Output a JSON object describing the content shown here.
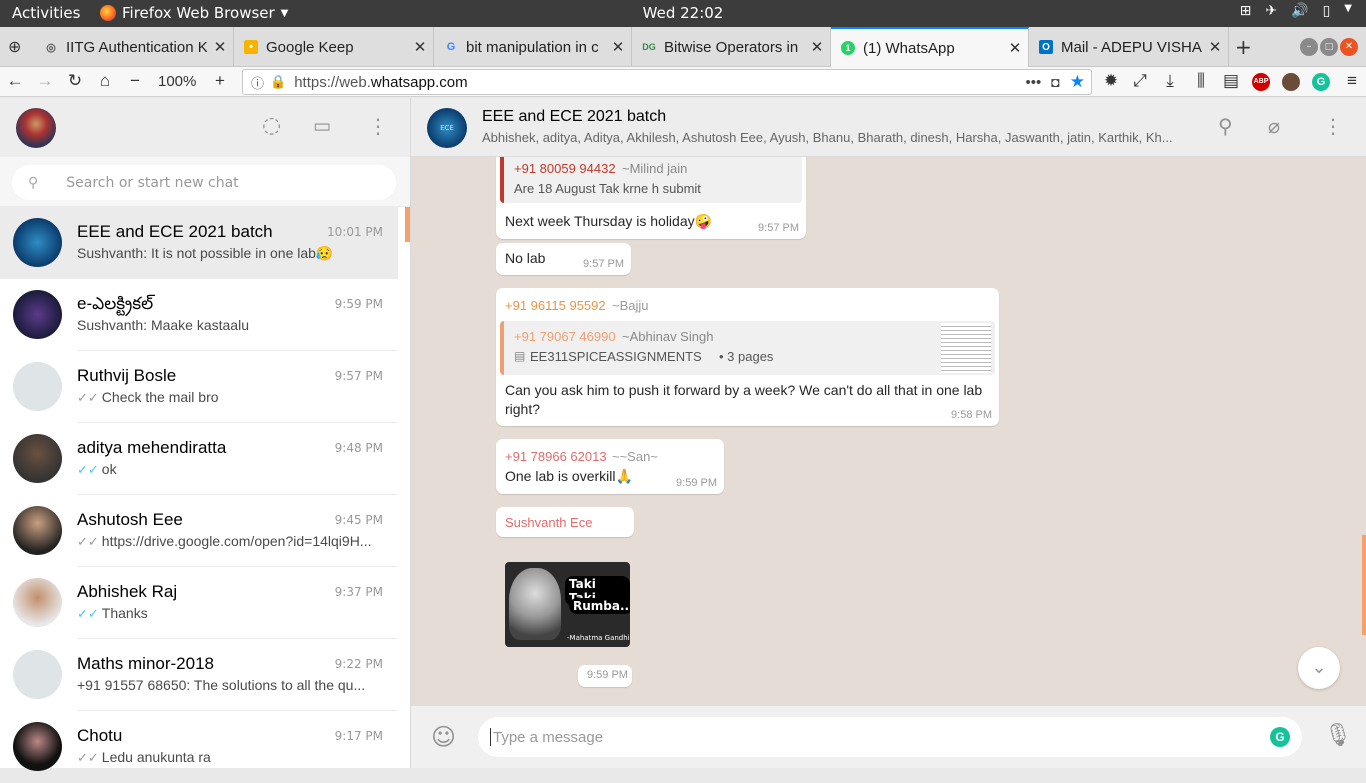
{
  "os": {
    "activities": "Activities",
    "app_name": "Firefox Web Browser",
    "clock": "Wed 22:02"
  },
  "tabs": [
    {
      "title": "IITG Authentication Keep",
      "fav": "globe"
    },
    {
      "title": "Google Keep",
      "fav": "keep"
    },
    {
      "title": "bit manipulation in c",
      "fav": "google"
    },
    {
      "title": "Bitwise Operators in",
      "fav": "gfg"
    },
    {
      "title": "(1) WhatsApp",
      "fav": "whatsapp"
    },
    {
      "title": "Mail - ADEPU VISHAL",
      "fav": "outlook"
    }
  ],
  "nav": {
    "zoom": "100%",
    "url_prefix": "https://web.",
    "url_host": "whatsapp.com",
    "abp": "ABP"
  },
  "sidebar": {
    "search_placeholder": "Search or start new chat",
    "chats": [
      {
        "name": "EEE and ECE 2021 batch",
        "time": "10:01 PM",
        "msg": "Sushvanth: It is not possible in one lab😥",
        "tick": ""
      },
      {
        "name": "e-ఎలక్ట్రికల్",
        "time": "9:59 PM",
        "msg": "Sushvanth: Maake kastaalu",
        "tick": ""
      },
      {
        "name": "Ruthvij Bosle",
        "time": "9:57 PM",
        "msg": "Check the mail bro",
        "tick": "✓✓"
      },
      {
        "name": "aditya mehendiratta",
        "time": "9:48 PM",
        "msg": "ok",
        "tick": "✓✓"
      },
      {
        "name": "Ashutosh Eee",
        "time": "9:45 PM",
        "msg": "https://drive.google.com/open?id=14lqi9H...",
        "tick": "✓✓"
      },
      {
        "name": "Abhishek Raj",
        "time": "9:37 PM",
        "msg": "Thanks",
        "tick": "✓✓"
      },
      {
        "name": "Maths minor-2018",
        "time": "9:22 PM",
        "msg": "+91 91557 68650: The solutions to all the qu...",
        "tick": ""
      },
      {
        "name": "Chotu",
        "time": "9:17 PM",
        "msg": "Ledu anukunta ra",
        "tick": "✓✓"
      }
    ]
  },
  "conversation": {
    "title": "EEE and ECE 2021 batch",
    "members": "Abhishek, aditya, Aditya, Akhilesh, Ashutosh Eee, Ayush, Bhanu, Bharath, dinesh, Harsha, Jaswanth, jatin, Karthik, Kh...",
    "group_avatar_text": "ECE",
    "messages": {
      "m1_quote_sender": "+91 80059 94432",
      "m1_quote_name": "~Milind jain",
      "m1_quote_text": "Are 18 August Tak krne h submit",
      "m1_text": "Next week Thursday is holiday🤪",
      "m1_time": "9:57 PM",
      "m2_text": "No lab",
      "m2_time": "9:57 PM",
      "m3_sender": "+91 96115 95592",
      "m3_name": "~Bajju",
      "m3_quote_sender": "+91 79067 46990",
      "m3_quote_name": "~Abhinav Singh",
      "m3_quote_doc": "EE311SPICEASSIGNMENTS",
      "m3_quote_pages": "• 3 pages",
      "m3_text": "Can you ask him to push it forward by a week? We can't do all that in one lab right?",
      "m3_time": "9:58 PM",
      "m4_sender": "+91 78966 62013",
      "m4_name": "~~San~",
      "m4_text": "One lab is overkill🙏",
      "m4_time": "9:59 PM",
      "m5_sender": "Sushvanth Ece",
      "sticker_line1": "Taki Taki",
      "sticker_line2": "Rumba..",
      "sticker_caption": "-Mahatma Gandhi",
      "m5_time": "9:59 PM"
    },
    "input_placeholder": "Type a message"
  },
  "colors": {
    "wa_bg": "#e5ddd5",
    "accent_green": "#00bfa5",
    "quote_red": "#c0392b",
    "quote_orange": "#f0a070",
    "sender_pink": "#e26b6b"
  }
}
